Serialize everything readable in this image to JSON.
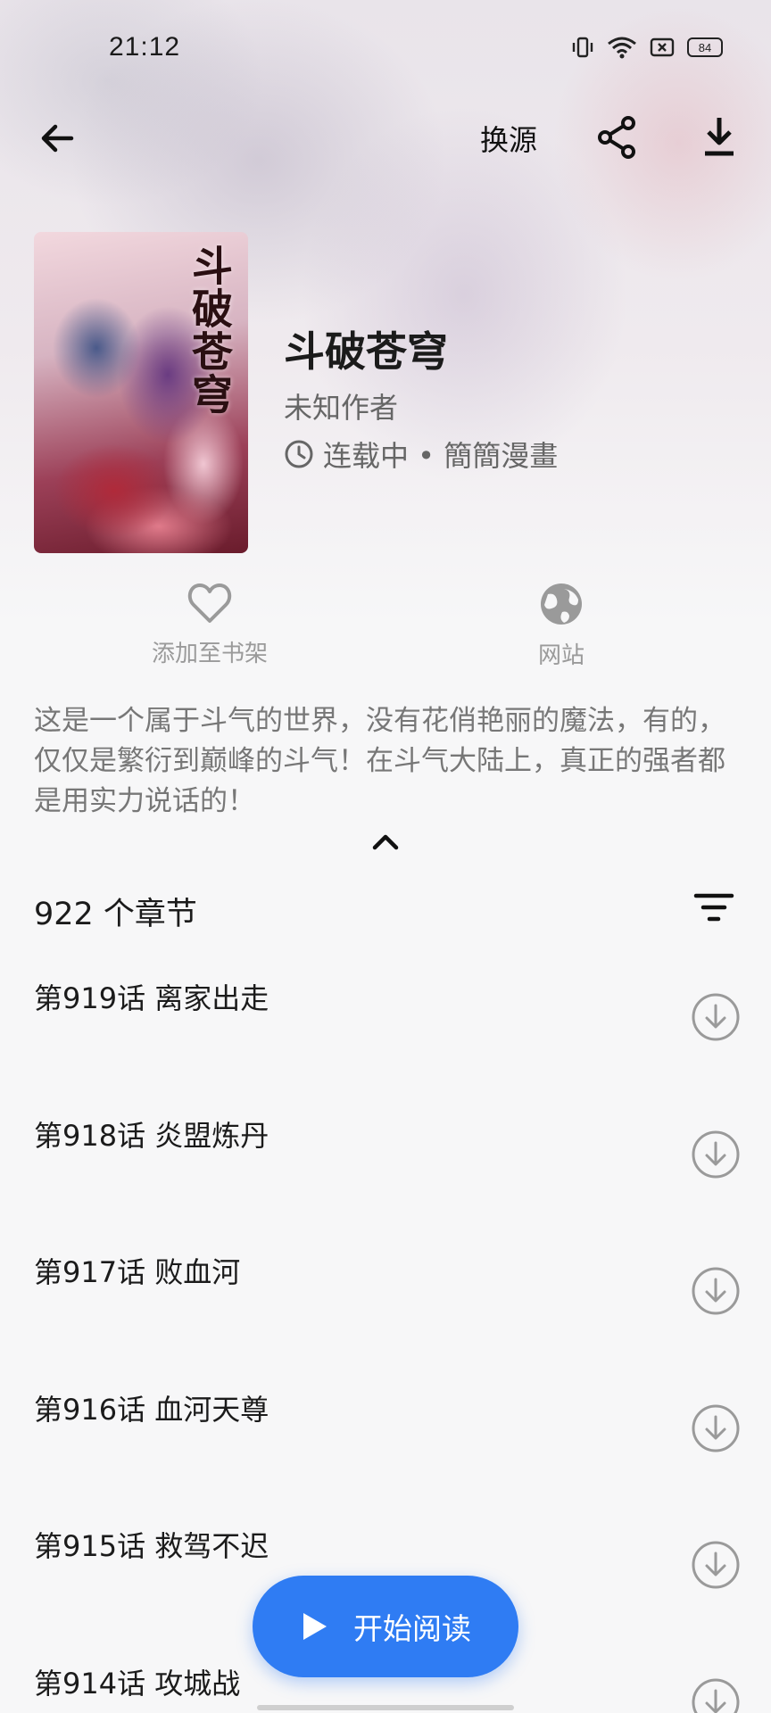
{
  "status_bar": {
    "time": "21:12",
    "battery": "84"
  },
  "top_bar": {
    "source_label": "换源"
  },
  "book": {
    "cover_title": "斗破苍穹",
    "title": "斗破苍穹",
    "author": "未知作者",
    "status": "连载中 • 簡簡漫畫"
  },
  "actions": {
    "favorite_label": "添加至书架",
    "website_label": "网站"
  },
  "intro": "这是一个属于斗气的世界，没有花俏艳丽的魔法，有的，仅仅是繁衍到巅峰的斗气！在斗气大陆上，真正的强者都是用实力说话的！",
  "chapters": {
    "count_label": "922 个章节",
    "items": [
      {
        "title": "第919话 离家出走"
      },
      {
        "title": "第918话 炎盟炼丹"
      },
      {
        "title": "第917话 败血河"
      },
      {
        "title": "第916话 血河天尊"
      },
      {
        "title": "第915话 救驾不迟"
      },
      {
        "title": "第914话 攻城战"
      }
    ]
  },
  "fab": {
    "label": "开始阅读"
  },
  "colors": {
    "accent": "#2f7cf3",
    "icon_gray": "#9a9a9a"
  }
}
